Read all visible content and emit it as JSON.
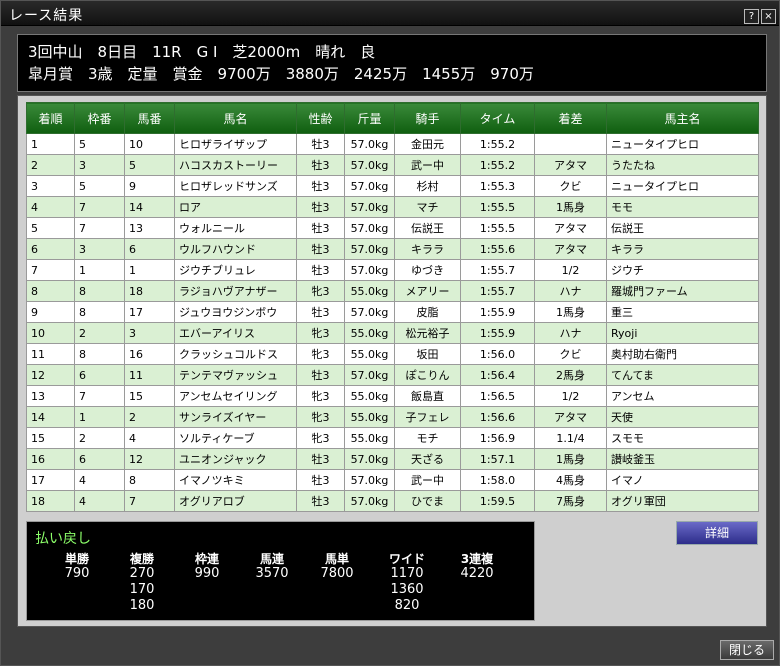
{
  "window": {
    "title": "レース結果",
    "help_label": "?",
    "close_label": "×"
  },
  "race": {
    "line1": "3回中山　8日目　11R　G I　芝2000m　晴れ　良",
    "line2": "皐月賞　3歳　定量　賞金　9700万　3880万　2425万　1455万　970万"
  },
  "table": {
    "headers": [
      "着順",
      "枠番",
      "馬番",
      "馬名",
      "性齢",
      "斤量",
      "騎手",
      "タイム",
      "着差",
      "馬主名"
    ],
    "rows": [
      [
        "1",
        "5",
        "10",
        "ヒロザライザップ",
        "牡3",
        "57.0kg",
        "金田元",
        "1:55.2",
        "",
        "ニュータイプヒロ"
      ],
      [
        "2",
        "3",
        "5",
        "ハコスカストーリー",
        "牡3",
        "57.0kg",
        "武ー中",
        "1:55.2",
        "アタマ",
        "うたたね"
      ],
      [
        "3",
        "5",
        "9",
        "ヒロザレッドサンズ",
        "牡3",
        "57.0kg",
        "杉村",
        "1:55.3",
        "クビ",
        "ニュータイプヒロ"
      ],
      [
        "4",
        "7",
        "14",
        "ロア",
        "牡3",
        "57.0kg",
        "マチ",
        "1:55.5",
        "1馬身",
        "モモ"
      ],
      [
        "5",
        "7",
        "13",
        "ウォルニール",
        "牡3",
        "57.0kg",
        "伝説王",
        "1:55.5",
        "アタマ",
        "伝説王"
      ],
      [
        "6",
        "3",
        "6",
        "ウルフハウンド",
        "牡3",
        "57.0kg",
        "キララ",
        "1:55.6",
        "アタマ",
        "キララ"
      ],
      [
        "7",
        "1",
        "1",
        "ジウチブリュレ",
        "牡3",
        "57.0kg",
        "ゆづき",
        "1:55.7",
        "1/2",
        "ジウチ"
      ],
      [
        "8",
        "8",
        "18",
        "ラジョハヴアナザー",
        "牝3",
        "55.0kg",
        "メアリー",
        "1:55.7",
        "ハナ",
        "羅城門ファーム"
      ],
      [
        "9",
        "8",
        "17",
        "ジュウヨウジンボウ",
        "牡3",
        "57.0kg",
        "皮脂",
        "1:55.9",
        "1馬身",
        "重三"
      ],
      [
        "10",
        "2",
        "3",
        "エバーアイリス",
        "牝3",
        "55.0kg",
        "松元裕子",
        "1:55.9",
        "ハナ",
        "Ryoji"
      ],
      [
        "11",
        "8",
        "16",
        "クラッシュコルドス",
        "牝3",
        "55.0kg",
        "坂田",
        "1:56.0",
        "クビ",
        "奥村助右衛門"
      ],
      [
        "12",
        "6",
        "11",
        "テンテマヴァッシュ",
        "牡3",
        "57.0kg",
        "ぽこりん",
        "1:56.4",
        "2馬身",
        "てんてま"
      ],
      [
        "13",
        "7",
        "15",
        "アンセムセイリング",
        "牝3",
        "55.0kg",
        "飯島直",
        "1:56.5",
        "1/2",
        "アンセム"
      ],
      [
        "14",
        "1",
        "2",
        "サンライズイヤー",
        "牝3",
        "55.0kg",
        "子フェレ",
        "1:56.6",
        "アタマ",
        "天使"
      ],
      [
        "15",
        "2",
        "4",
        "ソルティケーブ",
        "牝3",
        "55.0kg",
        "モチ",
        "1:56.9",
        "1.1/4",
        "スモモ"
      ],
      [
        "16",
        "6",
        "12",
        "ユニオンジャック",
        "牡3",
        "57.0kg",
        "天ざる",
        "1:57.1",
        "1馬身",
        "讃岐釜玉"
      ],
      [
        "17",
        "4",
        "8",
        "イマノツキミ",
        "牡3",
        "57.0kg",
        "武ー中",
        "1:58.0",
        "4馬身",
        "イマノ"
      ],
      [
        "18",
        "4",
        "7",
        "オグリアロブ",
        "牡3",
        "57.0kg",
        "ひでま",
        "1:59.5",
        "7馬身",
        "オグリ軍団"
      ]
    ]
  },
  "payout": {
    "title": "払い戻し",
    "columns": [
      {
        "label": "単勝",
        "values": [
          "790"
        ]
      },
      {
        "label": "複勝",
        "values": [
          "270",
          "170",
          "180"
        ]
      },
      {
        "label": "枠連",
        "values": [
          "990"
        ]
      },
      {
        "label": "馬連",
        "values": [
          "3570"
        ]
      },
      {
        "label": "馬単",
        "values": [
          "7800"
        ]
      },
      {
        "label": "ワイド",
        "values": [
          "1170",
          "1360",
          "820"
        ]
      },
      {
        "label": "3連複",
        "values": [
          "4220"
        ]
      }
    ]
  },
  "buttons": {
    "detail": "詳細",
    "close": "閉じる"
  }
}
